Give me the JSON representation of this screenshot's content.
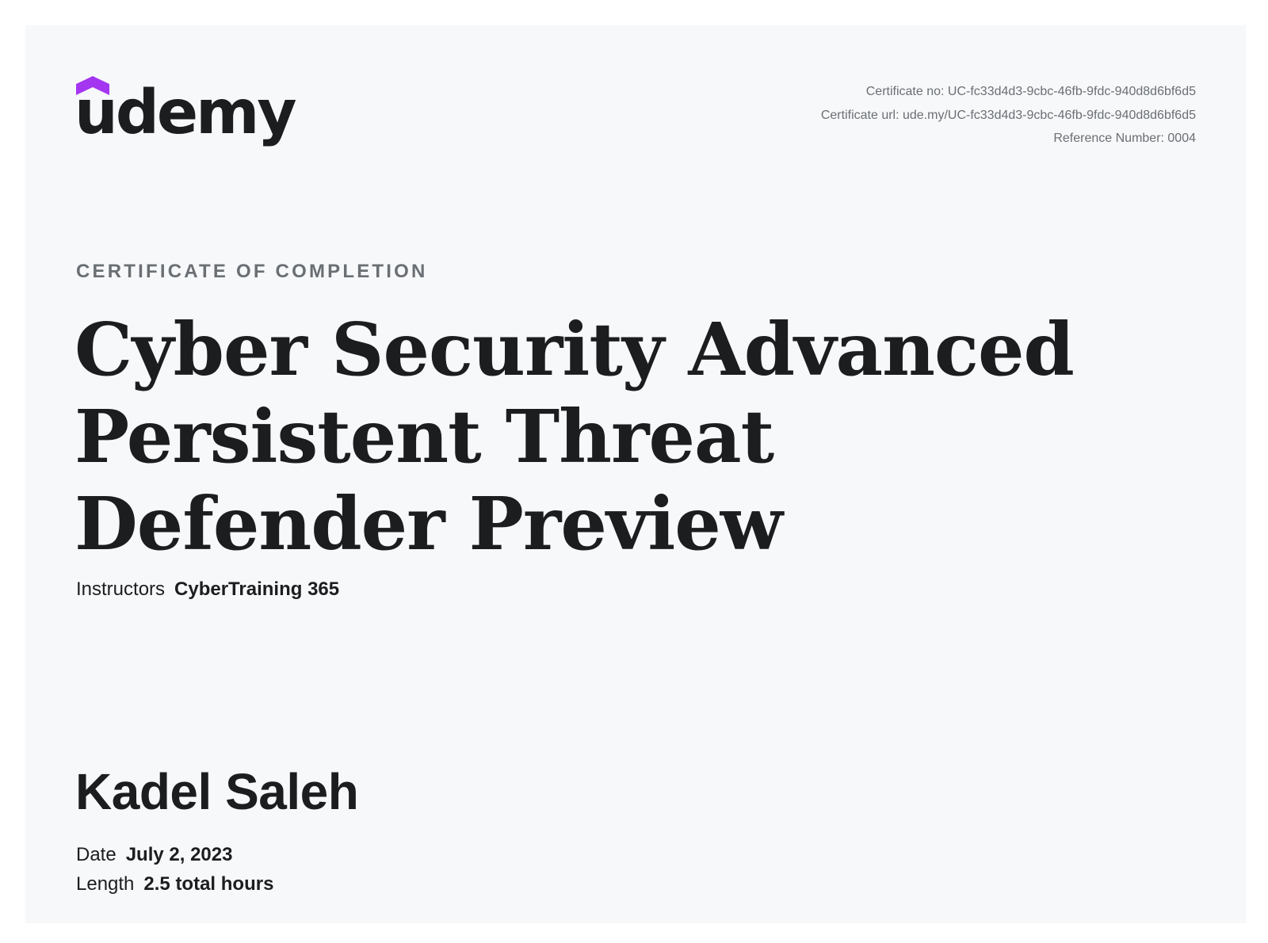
{
  "brand": {
    "logo_text": "udemy",
    "accent_color": "#a435f0",
    "text_color": "#1c1d1f"
  },
  "meta": {
    "certificate_no": "Certificate no: UC-fc33d4d3-9cbc-46fb-9fdc-940d8d6bf6d5",
    "certificate_url": "Certificate url: ude.my/UC-fc33d4d3-9cbc-46fb-9fdc-940d8d6bf6d5",
    "reference_number": "Reference Number: 0004"
  },
  "certificate": {
    "label": "CERTIFICATE OF COMPLETION",
    "course_title": "Cyber Security Advanced Persistent Threat Defender Preview",
    "instructors_label": "Instructors",
    "instructors_value": "CyberTraining 365",
    "recipient_name": "Kadel Saleh",
    "date_label": "Date",
    "date_value": "July 2, 2023",
    "length_label": "Length",
    "length_value": "2.5 total hours"
  }
}
